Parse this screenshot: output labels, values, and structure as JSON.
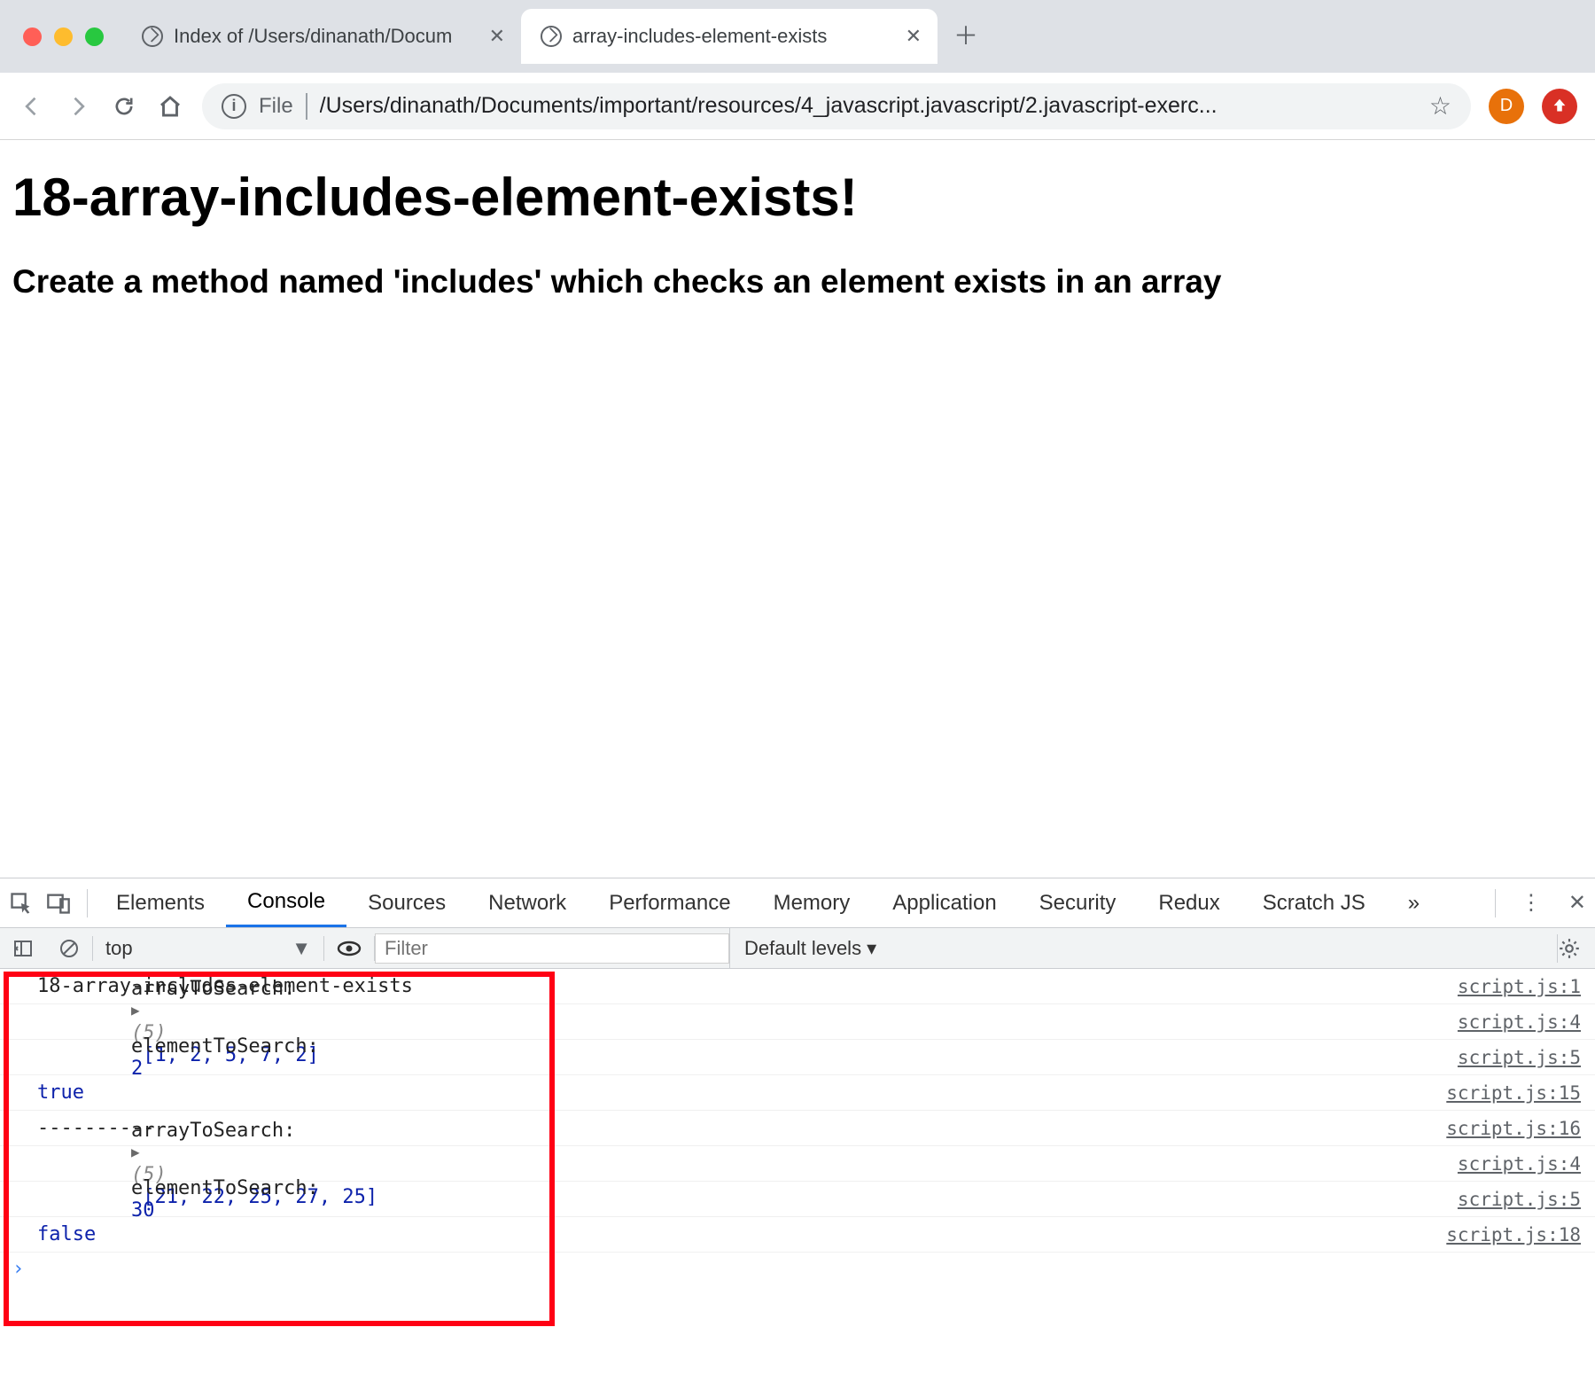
{
  "tabs": [
    {
      "title": "Index of /Users/dinanath/Docum",
      "active": false
    },
    {
      "title": "array-includes-element-exists",
      "active": true
    }
  ],
  "url": {
    "file_label": "File",
    "path": "/Users/dinanath/Documents/important/resources/4_javascript.javascript/2.javascript-exerc..."
  },
  "avatar_letter": "D",
  "page": {
    "h1": "18-array-includes-element-exists!",
    "h2": "Create a method named 'includes' which checks an element exists in an array"
  },
  "devtools": {
    "panels": [
      "Elements",
      "Console",
      "Sources",
      "Network",
      "Performance",
      "Memory",
      "Application",
      "Security",
      "Redux",
      "Scratch JS"
    ],
    "active_panel": "Console",
    "overflow": "»",
    "context": "top",
    "filter_placeholder": "Filter",
    "levels_label": "Default levels ▾",
    "console": [
      {
        "text": "18-array-includes-element-exists",
        "src": "script.js:1"
      },
      {
        "label": "arrayToSearch: ",
        "arr_len": "(5)",
        "arr": "[1, 2, 5, 7, 2]",
        "src": "script.js:4"
      },
      {
        "label": "elementToSearch:  ",
        "val": "2",
        "src": "script.js:5"
      },
      {
        "keyword": "true",
        "src": "script.js:15"
      },
      {
        "text": "----------",
        "src": "script.js:16"
      },
      {
        "label": "arrayToSearch: ",
        "arr_len": "(5)",
        "arr": "[21, 22, 25, 27, 25]",
        "src": "script.js:4"
      },
      {
        "label": "elementToSearch:  ",
        "val": "30",
        "src": "script.js:5"
      },
      {
        "keyword": "false",
        "src": "script.js:18"
      }
    ]
  }
}
